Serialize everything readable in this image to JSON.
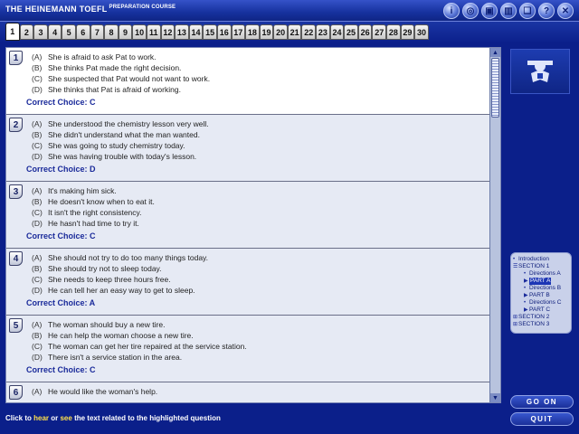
{
  "app": {
    "title": "THE HEINEMANN TOEFL",
    "subtitle": "PREPARATION COURSE"
  },
  "toolbar_icons": [
    {
      "name": "info-icon",
      "glyph": "i"
    },
    {
      "name": "tape-icon",
      "glyph": "◎"
    },
    {
      "name": "save-icon",
      "glyph": "▣"
    },
    {
      "name": "library-icon",
      "glyph": "▥"
    },
    {
      "name": "book-icon",
      "glyph": "❑"
    },
    {
      "name": "help-icon",
      "glyph": "?"
    },
    {
      "name": "close-icon",
      "glyph": "✕"
    }
  ],
  "tabs": [
    "1",
    "2",
    "3",
    "4",
    "5",
    "6",
    "7",
    "8",
    "9",
    "10",
    "11",
    "12",
    "13",
    "14",
    "15",
    "16",
    "17",
    "18",
    "19",
    "20",
    "21",
    "22",
    "23",
    "24",
    "25",
    "26",
    "27",
    "28",
    "29",
    "30"
  ],
  "active_tab": "1",
  "questions": [
    {
      "num": "1",
      "options": [
        {
          "letter": "(A)",
          "text": "She is afraid to ask Pat to work."
        },
        {
          "letter": "(B)",
          "text": "She thinks Pat made the right decision."
        },
        {
          "letter": "(C)",
          "text": "She suspected that Pat would not want to work."
        },
        {
          "letter": "(D)",
          "text": "She thinks that Pat is afraid of working."
        }
      ],
      "correct": "Correct Choice: C"
    },
    {
      "num": "2",
      "options": [
        {
          "letter": "(A)",
          "text": "She understood the chemistry lesson very well."
        },
        {
          "letter": "(B)",
          "text": "She didn't understand what the man wanted."
        },
        {
          "letter": "(C)",
          "text": "She was going to study chemistry today."
        },
        {
          "letter": "(D)",
          "text": "She was having trouble with today's lesson."
        }
      ],
      "correct": "Correct Choice: D"
    },
    {
      "num": "3",
      "options": [
        {
          "letter": "(A)",
          "text": "It's making him sick."
        },
        {
          "letter": "(B)",
          "text": "He doesn't know when to eat it."
        },
        {
          "letter": "(C)",
          "text": "It isn't the right consistency."
        },
        {
          "letter": "(D)",
          "text": "He hasn't had time to try it."
        }
      ],
      "correct": "Correct Choice: C"
    },
    {
      "num": "4",
      "options": [
        {
          "letter": "(A)",
          "text": "She should not try to do too many things today."
        },
        {
          "letter": "(B)",
          "text": "She should try not to sleep today."
        },
        {
          "letter": "(C)",
          "text": "She needs to keep three hours free."
        },
        {
          "letter": "(D)",
          "text": "He can tell her an easy way to get to sleep."
        }
      ],
      "correct": "Correct Choice: A"
    },
    {
      "num": "5",
      "options": [
        {
          "letter": "(A)",
          "text": "The woman should buy a new tire."
        },
        {
          "letter": "(B)",
          "text": "He can help the woman choose a new tire."
        },
        {
          "letter": "(C)",
          "text": "The woman can get her tire repaired at the service station."
        },
        {
          "letter": "(D)",
          "text": "There isn't a service station in the area."
        }
      ],
      "correct": "Correct Choice: C"
    },
    {
      "num": "6",
      "options": [
        {
          "letter": "(A)",
          "text": "He would like the woman's help."
        }
      ],
      "correct": ""
    }
  ],
  "nav_tree": [
    {
      "label": "Introduction",
      "marker": "•",
      "level": 0,
      "selected": false
    },
    {
      "label": "SECTION 1",
      "marker": "☰",
      "level": 0,
      "selected": false
    },
    {
      "label": "Directions A",
      "marker": "•",
      "level": 1,
      "selected": false
    },
    {
      "label": "PART A",
      "marker": "▶",
      "level": 1,
      "selected": true
    },
    {
      "label": "Directions B",
      "marker": "•",
      "level": 1,
      "selected": false
    },
    {
      "label": "PART B",
      "marker": "▶",
      "level": 1,
      "selected": false
    },
    {
      "label": "Directions C",
      "marker": "•",
      "level": 1,
      "selected": false
    },
    {
      "label": "PART C",
      "marker": "▶",
      "level": 1,
      "selected": false
    },
    {
      "label": "SECTION 2",
      "marker": "⊞",
      "level": 0,
      "selected": false
    },
    {
      "label": "SECTION 3",
      "marker": "⊞",
      "level": 0,
      "selected": false
    }
  ],
  "buttons": {
    "go_on": "GO ON",
    "quit": "QUIT"
  },
  "status": {
    "pre": "Click to ",
    "hear": "hear",
    "mid": " or ",
    "see": "see",
    "post": " the text related to the highlighted question"
  },
  "colors": {
    "background": "#0b1f8a",
    "correct_choice": "#1a2a9a",
    "status_highlight": "#ffe04a"
  }
}
